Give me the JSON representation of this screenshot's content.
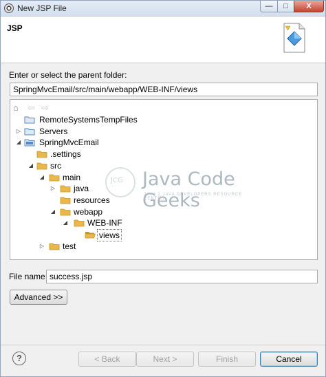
{
  "window": {
    "title": "New JSP File",
    "minimize_glyph": "—",
    "maximize_glyph": "□",
    "close_glyph": "X"
  },
  "header": {
    "title": "JSP",
    "icon": "jsp-wizard-icon"
  },
  "parent_folder": {
    "label": "Enter or select the parent folder:",
    "value": "SpringMvcEmail/src/main/webapp/WEB-INF/views"
  },
  "tree_toolbar": {
    "home_glyph": "⌂",
    "back_glyph": "⇦",
    "forward_glyph": "⇨"
  },
  "tree": {
    "nodes": [
      {
        "label": "RemoteSystemsTempFiles",
        "twisty": ""
      },
      {
        "label": "Servers",
        "twisty": "▷"
      },
      {
        "label": "SpringMvcEmail",
        "twisty": "◢"
      },
      {
        "label": ".settings",
        "twisty": ""
      },
      {
        "label": "src",
        "twisty": "◢"
      },
      {
        "label": "main",
        "twisty": "◢"
      },
      {
        "label": "java",
        "twisty": "▷"
      },
      {
        "label": "resources",
        "twisty": ""
      },
      {
        "label": "webapp",
        "twisty": "◢"
      },
      {
        "label": "WEB-INF",
        "twisty": "◢"
      },
      {
        "label": "views",
        "twisty": ""
      },
      {
        "label": "test",
        "twisty": "▷"
      }
    ]
  },
  "watermark": {
    "logo_text": "JCG",
    "title": "Java Code Geeks",
    "subtitle": "JAVA 2 JAVA DEVELOPERS RESOURCE CENTER"
  },
  "file_name": {
    "label": "File name:",
    "value": "success.jsp"
  },
  "buttons": {
    "advanced": "Advanced >>",
    "help": "?",
    "back": "< Back",
    "next": "Next >",
    "finish": "Finish",
    "cancel": "Cancel"
  },
  "colors": {
    "folder": "#e8b84a",
    "folder_dark": "#c9932a",
    "project": "#5a87c5",
    "accent": "#3c7fb1"
  }
}
